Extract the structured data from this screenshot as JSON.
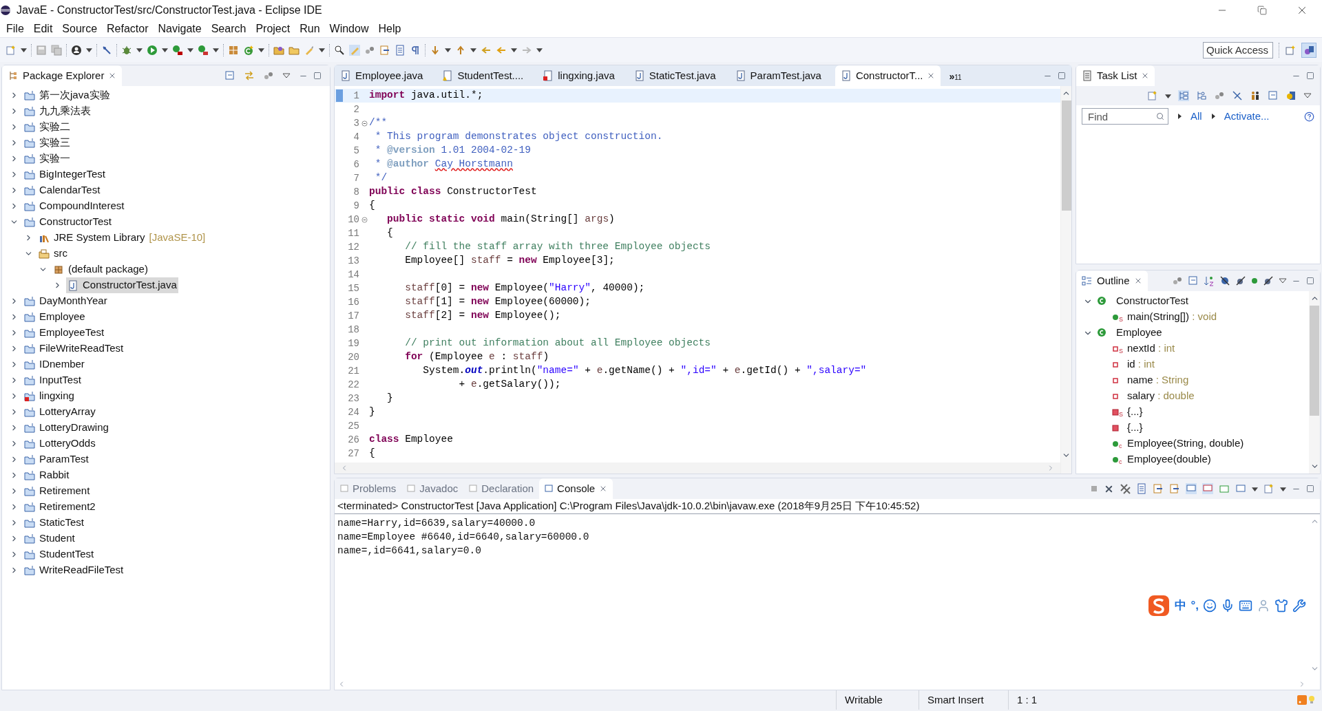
{
  "window": {
    "title": "JavaE - ConstructorTest/src/ConstructorTest.java - Eclipse IDE"
  },
  "menu": [
    "File",
    "Edit",
    "Source",
    "Refactor",
    "Navigate",
    "Search",
    "Project",
    "Run",
    "Window",
    "Help"
  ],
  "quick_access": {
    "placeholder": "Quick Access"
  },
  "package_explorer": {
    "title": "Package Explorer",
    "items": [
      {
        "label": "第一次java实验",
        "kind": "project",
        "expanded": false,
        "selected": false
      },
      {
        "label": "九九乘法表",
        "kind": "project",
        "expanded": false,
        "selected": false
      },
      {
        "label": "实验二",
        "kind": "project",
        "expanded": false,
        "selected": false
      },
      {
        "label": "实验三",
        "kind": "project",
        "expanded": false,
        "selected": false
      },
      {
        "label": "实验一",
        "kind": "project",
        "expanded": false,
        "selected": false
      },
      {
        "label": "BigIntegerTest",
        "kind": "project",
        "expanded": false,
        "selected": false
      },
      {
        "label": "CalendarTest",
        "kind": "project",
        "expanded": false,
        "selected": false
      },
      {
        "label": "CompoundInterest",
        "kind": "project",
        "expanded": false,
        "selected": false
      },
      {
        "label": "ConstructorTest",
        "kind": "project",
        "expanded": true,
        "selected": false,
        "children": [
          {
            "label": "JRE System Library",
            "decoration": "[JavaSE-10]",
            "kind": "library",
            "expanded": false,
            "selected": false
          },
          {
            "label": "src",
            "kind": "source",
            "expanded": true,
            "selected": false,
            "children": [
              {
                "label": "(default package)",
                "kind": "package",
                "expanded": true,
                "selected": false,
                "children": [
                  {
                    "label": "ConstructorTest.java",
                    "kind": "file",
                    "expanded": false,
                    "selected": true
                  }
                ]
              }
            ]
          }
        ]
      },
      {
        "label": "DayMonthYear",
        "kind": "project",
        "expanded": false,
        "selected": false
      },
      {
        "label": "Employee",
        "kind": "project",
        "expanded": false,
        "selected": false
      },
      {
        "label": "EmployeeTest",
        "kind": "project",
        "expanded": false,
        "selected": false
      },
      {
        "label": "FileWriteReadTest",
        "kind": "project",
        "expanded": false,
        "selected": false
      },
      {
        "label": "IDnember",
        "kind": "project",
        "expanded": false,
        "selected": false
      },
      {
        "label": "InputTest",
        "kind": "project",
        "expanded": false,
        "selected": false
      },
      {
        "label": "lingxing",
        "kind": "project_error",
        "expanded": false,
        "selected": false
      },
      {
        "label": "LotteryArray",
        "kind": "project",
        "expanded": false,
        "selected": false
      },
      {
        "label": "LotteryDrawing",
        "kind": "project",
        "expanded": false,
        "selected": false
      },
      {
        "label": "LotteryOdds",
        "kind": "project",
        "expanded": false,
        "selected": false
      },
      {
        "label": "ParamTest",
        "kind": "project",
        "expanded": false,
        "selected": false
      },
      {
        "label": "Rabbit",
        "kind": "project",
        "expanded": false,
        "selected": false
      },
      {
        "label": "Retirement",
        "kind": "project",
        "expanded": false,
        "selected": false
      },
      {
        "label": "Retirement2",
        "kind": "project",
        "expanded": false,
        "selected": false
      },
      {
        "label": "StaticTest",
        "kind": "project",
        "expanded": false,
        "selected": false
      },
      {
        "label": "Student",
        "kind": "project",
        "expanded": false,
        "selected": false
      },
      {
        "label": "StudentTest",
        "kind": "project",
        "expanded": false,
        "selected": false
      },
      {
        "label": "WriteReadFileTest",
        "kind": "project",
        "expanded": false,
        "selected": false
      }
    ]
  },
  "editor": {
    "tabs": [
      {
        "label": "Employee.java",
        "kind": "java",
        "selected": false
      },
      {
        "label": "StudentTest....",
        "kind": "warning",
        "selected": false
      },
      {
        "label": "lingxing.java",
        "kind": "error",
        "selected": false
      },
      {
        "label": "StaticTest.java",
        "kind": "java",
        "selected": false
      },
      {
        "label": "ParamTest.java",
        "kind": "java",
        "selected": false
      },
      {
        "label": "ConstructorT...",
        "kind": "java",
        "selected": true
      }
    ],
    "overflow": {
      "symbol": "»",
      "count": "11"
    },
    "lines": [
      {
        "number": "1",
        "fold": false,
        "current": true,
        "tokens": [
          {
            "kind": "kw",
            "text": "import"
          },
          {
            "kind": "plain",
            "text": " java.util.*;"
          }
        ]
      },
      {
        "number": "2",
        "fold": false,
        "current": false
      },
      {
        "number": "3",
        "fold": true,
        "current": false,
        "tokens": [
          {
            "kind": "javadoc",
            "text": "/**"
          }
        ]
      },
      {
        "number": "4",
        "fold": false,
        "current": false,
        "tokens": [
          {
            "kind": "javadoc",
            "text": " * This program demonstrates object construction."
          }
        ]
      },
      {
        "number": "5",
        "fold": false,
        "current": false,
        "tokens": [
          {
            "kind": "javadoc",
            "text": " * "
          },
          {
            "kind": "tag",
            "text": "@version"
          },
          {
            "kind": "javadoc",
            "text": " 1.01 2004-02-19"
          }
        ]
      },
      {
        "number": "6",
        "fold": false,
        "current": false,
        "tokens": [
          {
            "kind": "javadoc",
            "text": " * "
          },
          {
            "kind": "tag",
            "text": "@author "
          },
          {
            "kind": "misspelled",
            "text": "Cay Horstmann"
          }
        ]
      },
      {
        "number": "7",
        "fold": false,
        "current": false,
        "tokens": [
          {
            "kind": "javadoc",
            "text": " */"
          }
        ]
      },
      {
        "number": "8",
        "fold": false,
        "current": false,
        "tokens": [
          {
            "kind": "kw",
            "text": "public "
          },
          {
            "kind": "kw",
            "text": "class"
          },
          {
            "kind": "plain",
            "text": " ConstructorTest"
          }
        ]
      },
      {
        "number": "9",
        "fold": false,
        "current": false,
        "tokens": [
          {
            "kind": "plain",
            "text": "{"
          }
        ]
      },
      {
        "number": "10",
        "fold": true,
        "current": false,
        "tokens": [
          {
            "kind": "kw",
            "text": "   public "
          },
          {
            "kind": "kw",
            "text": "static "
          },
          {
            "kind": "kw",
            "text": "void"
          },
          {
            "kind": "plain",
            "text": " main(String[] "
          },
          {
            "kind": "var",
            "text": "args"
          },
          {
            "kind": "plain",
            "text": ")"
          }
        ]
      },
      {
        "number": "11",
        "fold": false,
        "current": false,
        "tokens": [
          {
            "kind": "plain",
            "text": "   {"
          }
        ]
      },
      {
        "number": "12",
        "fold": false,
        "current": false,
        "tokens": [
          {
            "kind": "comment",
            "text": "      // fill the staff array with three Employee objects"
          }
        ]
      },
      {
        "number": "13",
        "fold": false,
        "current": false,
        "tokens": [
          {
            "kind": "plain",
            "text": "      Employee[] "
          },
          {
            "kind": "var",
            "text": "staff"
          },
          {
            "kind": "plain",
            "text": " = "
          },
          {
            "kind": "kw",
            "text": "new"
          },
          {
            "kind": "plain",
            "text": " Employee[3];"
          }
        ]
      },
      {
        "number": "14",
        "fold": false,
        "current": false
      },
      {
        "number": "15",
        "fold": false,
        "current": false,
        "tokens": [
          {
            "kind": "var",
            "text": "      staff"
          },
          {
            "kind": "plain",
            "text": "[0] = "
          },
          {
            "kind": "kw",
            "text": "new"
          },
          {
            "kind": "plain",
            "text": " Employee("
          },
          {
            "kind": "string",
            "text": "\"Harry\""
          },
          {
            "kind": "plain",
            "text": ", 40000);"
          }
        ]
      },
      {
        "number": "16",
        "fold": false,
        "current": false,
        "tokens": [
          {
            "kind": "var",
            "text": "      staff"
          },
          {
            "kind": "plain",
            "text": "[1] = "
          },
          {
            "kind": "kw",
            "text": "new"
          },
          {
            "kind": "plain",
            "text": " Employee(60000);"
          }
        ]
      },
      {
        "number": "17",
        "fold": false,
        "current": false,
        "tokens": [
          {
            "kind": "var",
            "text": "      staff"
          },
          {
            "kind": "plain",
            "text": "[2] = "
          },
          {
            "kind": "kw",
            "text": "new"
          },
          {
            "kind": "plain",
            "text": " Employee();"
          }
        ]
      },
      {
        "number": "18",
        "fold": false,
        "current": false
      },
      {
        "number": "19",
        "fold": false,
        "current": false,
        "tokens": [
          {
            "kind": "comment",
            "text": "      // print out information about all Employee objects"
          }
        ]
      },
      {
        "number": "20",
        "fold": false,
        "current": false,
        "tokens": [
          {
            "kind": "kw",
            "text": "      for"
          },
          {
            "kind": "plain",
            "text": " (Employee "
          },
          {
            "kind": "var",
            "text": "e"
          },
          {
            "kind": "plain",
            "text": " : "
          },
          {
            "kind": "var",
            "text": "staff"
          },
          {
            "kind": "plain",
            "text": ")"
          }
        ]
      },
      {
        "number": "21",
        "fold": false,
        "current": false,
        "tokens": [
          {
            "kind": "plain",
            "text": "         System."
          },
          {
            "kind": "field",
            "text": "out"
          },
          {
            "kind": "plain",
            "text": ".println("
          },
          {
            "kind": "string",
            "text": "\"name=\""
          },
          {
            "kind": "plain",
            "text": " + "
          },
          {
            "kind": "var",
            "text": "e"
          },
          {
            "kind": "plain",
            "text": ".getName() + "
          },
          {
            "kind": "string",
            "text": "\",id=\""
          },
          {
            "kind": "plain",
            "text": " + "
          },
          {
            "kind": "var",
            "text": "e"
          },
          {
            "kind": "plain",
            "text": ".getId() + "
          },
          {
            "kind": "string",
            "text": "\",salary=\""
          }
        ]
      },
      {
        "number": "22",
        "fold": false,
        "current": false,
        "tokens": [
          {
            "kind": "plain",
            "text": "               + "
          },
          {
            "kind": "var",
            "text": "e"
          },
          {
            "kind": "plain",
            "text": ".getSalary());"
          }
        ]
      },
      {
        "number": "23",
        "fold": false,
        "current": false,
        "tokens": [
          {
            "kind": "plain",
            "text": "   }"
          }
        ]
      },
      {
        "number": "24",
        "fold": false,
        "current": false,
        "tokens": [
          {
            "kind": "plain",
            "text": "}"
          }
        ]
      },
      {
        "number": "25",
        "fold": false,
        "current": false
      },
      {
        "number": "26",
        "fold": false,
        "current": false,
        "tokens": [
          {
            "kind": "kw",
            "text": "class"
          },
          {
            "kind": "plain",
            "text": " Employee"
          }
        ]
      },
      {
        "number": "27",
        "fold": false,
        "current": false,
        "tokens": [
          {
            "kind": "plain",
            "text": "{"
          }
        ]
      }
    ]
  },
  "task_list": {
    "title": "Task List",
    "find": {
      "placeholder": "Find"
    },
    "links": [
      "All",
      "Activate..."
    ]
  },
  "outline": {
    "title": "Outline",
    "items": [
      {
        "label": "ConstructorTest",
        "kind": "class",
        "expanded": true,
        "children": [
          {
            "label": "main(String[])",
            "type": " : void",
            "kind": "method",
            "modifier": "S"
          }
        ]
      },
      {
        "label": "Employee",
        "kind": "class",
        "expanded": true,
        "children": [
          {
            "label": "nextId",
            "type": " : int",
            "kind": "field",
            "modifier": "S"
          },
          {
            "label": "id",
            "type": " : int",
            "kind": "field"
          },
          {
            "label": "name",
            "type": " : String",
            "kind": "field"
          },
          {
            "label": "salary",
            "type": " : double",
            "kind": "field"
          },
          {
            "label": "{...}",
            "kind": "initializer",
            "modifier": "S"
          },
          {
            "label": "{...}",
            "kind": "initializer"
          },
          {
            "label": "Employee(String, double)",
            "kind": "method",
            "modifier": "c"
          },
          {
            "label": "Employee(double)",
            "kind": "method",
            "modifier": "c"
          }
        ]
      }
    ]
  },
  "bottom_tabs": [
    {
      "label": "Problems",
      "selected": false
    },
    {
      "label": "Javadoc",
      "selected": false
    },
    {
      "label": "Declaration",
      "selected": false
    },
    {
      "label": "Console",
      "selected": true
    }
  ],
  "console": {
    "header": "<terminated> ConstructorTest [Java Application] C:\\Program Files\\Java\\jdk-10.0.2\\bin\\javaw.exe (2018年9月25日 下午10:45:52)",
    "lines": [
      "name=Harry,id=6639,salary=40000.0",
      "name=Employee #6640,id=6640,salary=60000.0",
      "name=,id=6641,salary=0.0"
    ]
  },
  "ime_bar": {
    "mode": "中",
    "punctuation": "°,"
  },
  "status_bar": [
    "Writable",
    "Smart Insert",
    "1 : 1"
  ]
}
